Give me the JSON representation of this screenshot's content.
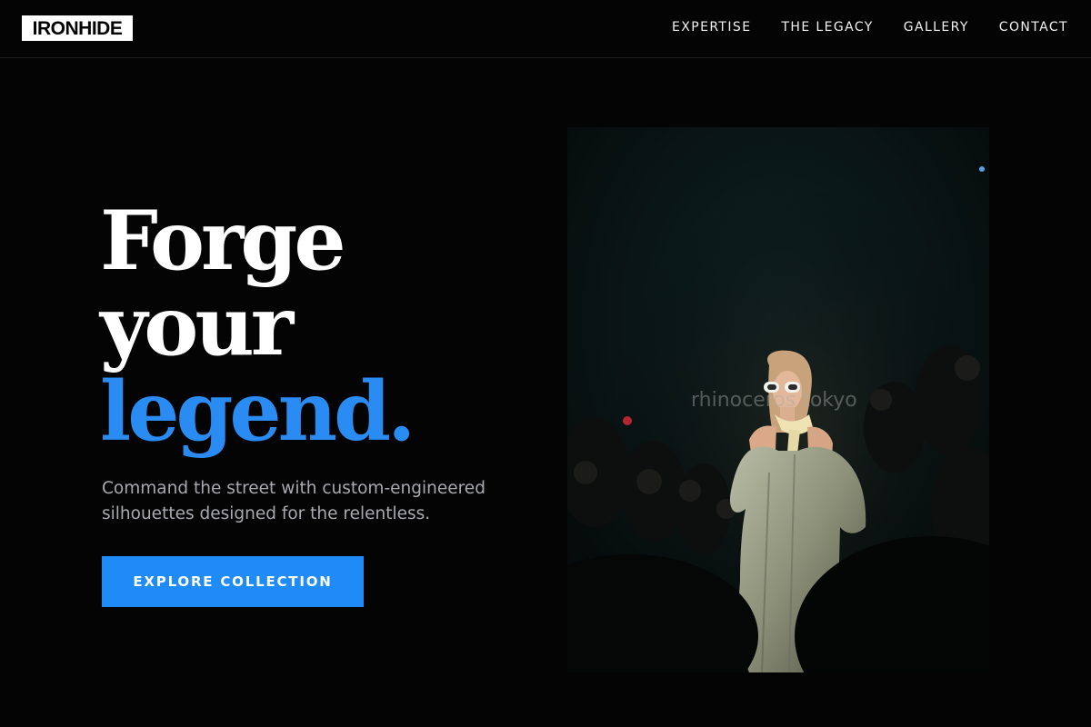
{
  "brand": {
    "logo_text": "IRONHIDE"
  },
  "nav": {
    "items": [
      {
        "label": "EXPERTISE"
      },
      {
        "label": "THE LEGACY"
      },
      {
        "label": "GALLERY"
      },
      {
        "label": "CONTACT"
      }
    ]
  },
  "hero": {
    "headline": {
      "line1": "Forge",
      "line2": "your",
      "line3": "legend."
    },
    "subtext": "Command the street with custom-engineered silhouettes designed for the relentless.",
    "cta_label": "EXPLORE COLLECTION",
    "image": {
      "watermark": "rhinoceros tokyo"
    }
  },
  "colors": {
    "background": "#040404",
    "accent": "#1f8bf7",
    "text_primary": "#ffffff",
    "text_secondary": "#a9aab0"
  }
}
